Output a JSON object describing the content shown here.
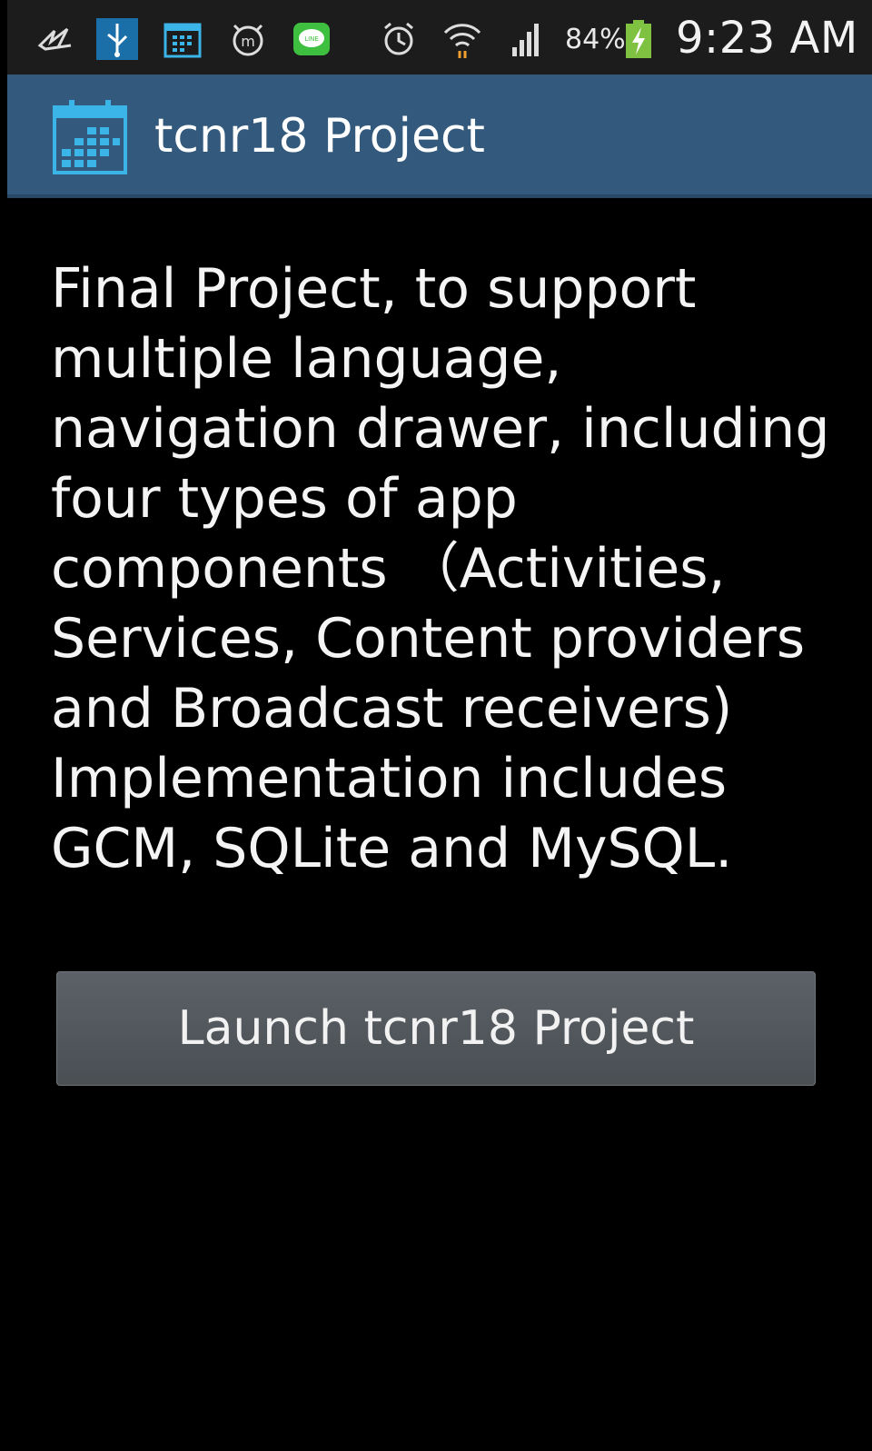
{
  "status_bar": {
    "icons": [
      "sparrow-icon",
      "usb-icon",
      "calendar-icon",
      "mcdonalds-icon",
      "line-app-icon",
      "alarm-icon",
      "wifi-icon",
      "signal-icon",
      "battery-charging-icon"
    ],
    "battery_percent": "84%",
    "time": "9:23 AM"
  },
  "action_bar": {
    "icon": "calendar-icon",
    "title": "tcnr18 Project",
    "color": "#335a7d"
  },
  "main": {
    "description": "Final Project, to support multiple language, navigation drawer, including four types of app components （Activities, Services, Content providers and Broadcast receivers) Implementation includes GCM, SQLite and MySQL.",
    "launch_button_label": "Launch tcnr18 Project"
  }
}
